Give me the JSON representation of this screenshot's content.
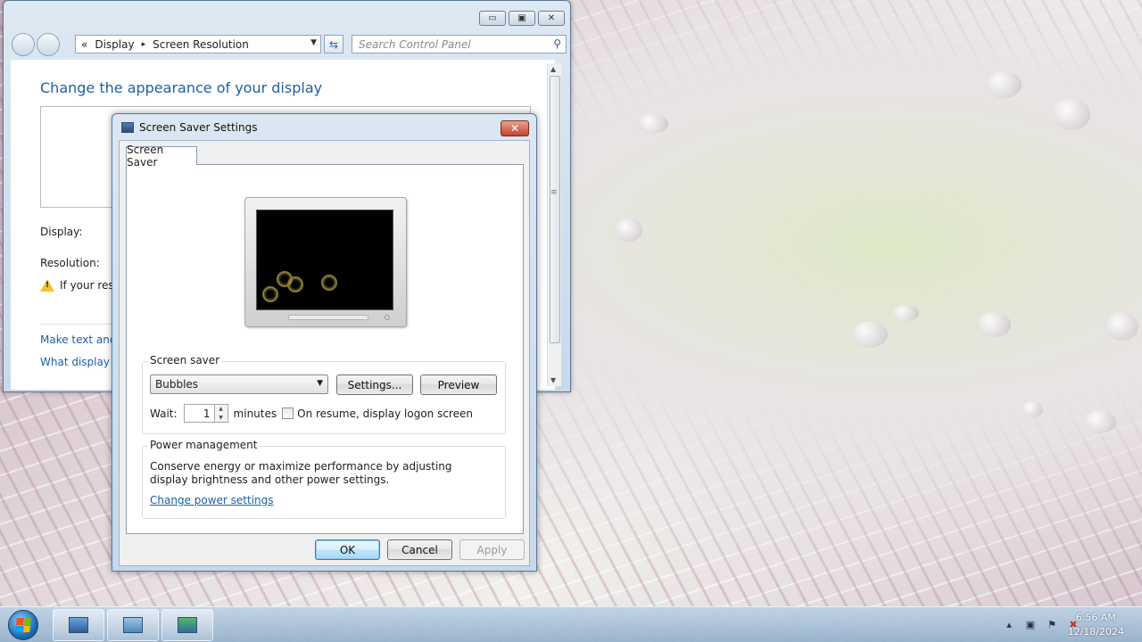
{
  "control_panel": {
    "breadcrumb": {
      "sep_back": "«",
      "item1": "Display",
      "sep": "▸",
      "item2": "Screen Resolution"
    },
    "search_placeholder": "Search Control Panel",
    "title": "Change the appearance of your display",
    "display_label": "Display:",
    "resolution_label": "Resolution:",
    "warning_text": "If your reso",
    "link1": "Make text and o",
    "link2": "What display se",
    "caption_min": "▭",
    "caption_max": "▣",
    "caption_close": "✕"
  },
  "dialog": {
    "title": "Screen Saver Settings",
    "close": "✕",
    "tab": "Screen Saver",
    "screen_saver_group": "Screen saver",
    "selected_screensaver": "Bubbles",
    "settings_button": "Settings...",
    "preview_button": "Preview",
    "wait_label": "Wait:",
    "wait_value": "1",
    "minutes_label": "minutes",
    "resume_checkbox_label": "On resume, display logon screen",
    "power_group": "Power management",
    "power_text": "Conserve energy or maximize performance by adjusting display brightness and other power settings.",
    "power_link": "Change power settings",
    "ok": "OK",
    "cancel": "Cancel",
    "apply": "Apply"
  },
  "taskbar": {
    "time": "6:56 AM",
    "date": "12/18/2024",
    "tray_arrow": "▴",
    "tray_icons": [
      "network-icon",
      "action-center-flag-icon",
      "volume-muted-icon"
    ]
  },
  "colors": {
    "link": "#1e5fa6",
    "accent": "#3c7fb1"
  }
}
